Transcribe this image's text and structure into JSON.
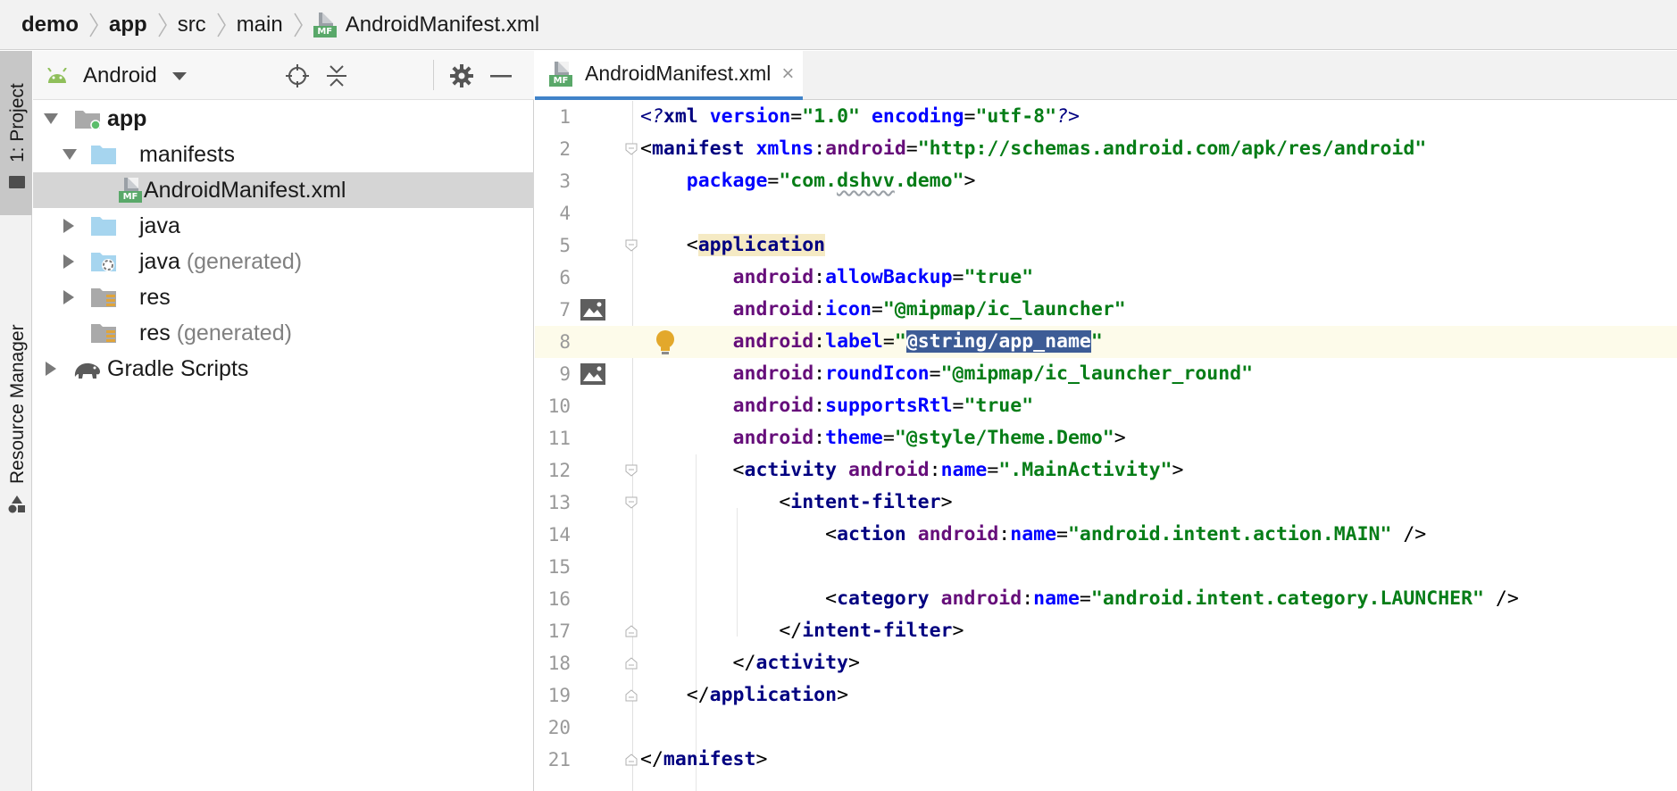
{
  "breadcrumb": {
    "items": [
      "demo",
      "app",
      "src",
      "main"
    ],
    "file": "AndroidManifest.xml",
    "file_icon_tag": "MF"
  },
  "tool_stripe": {
    "project_label": "1: Project",
    "resource_label": "Resource Manager"
  },
  "project_panel": {
    "view_mode": "Android",
    "icons": [
      "android-icon",
      "locate-icon",
      "collapse-all-icon",
      "gear-icon",
      "minimize-icon"
    ],
    "tree": [
      {
        "label": "app",
        "suffix": "",
        "expanded": true,
        "icon": "module-folder-icon"
      },
      {
        "label": "manifests",
        "suffix": "",
        "expanded": true,
        "icon": "folder-icon"
      },
      {
        "label": "AndroidManifest.xml",
        "suffix": "",
        "selected": true,
        "icon": "manifest-file-icon"
      },
      {
        "label": "java",
        "suffix": "",
        "expanded": false,
        "icon": "folder-icon"
      },
      {
        "label": "java",
        "suffix": "(generated)",
        "expanded": false,
        "icon": "generated-folder-icon"
      },
      {
        "label": "res",
        "suffix": "",
        "expanded": false,
        "icon": "resource-folder-icon"
      },
      {
        "label": "res",
        "suffix": "(generated)",
        "icon": "resource-folder-icon"
      },
      {
        "label": "Gradle Scripts",
        "suffix": "",
        "expanded": false,
        "icon": "gradle-elephant-icon"
      }
    ]
  },
  "editor": {
    "tab_label": "AndroidManifest.xml",
    "tab_close": "×",
    "current_line": 8,
    "line_numbers": [
      "1",
      "2",
      "3",
      "4",
      "5",
      "6",
      "7",
      "8",
      "9",
      "10",
      "11",
      "12",
      "13",
      "14",
      "15",
      "16",
      "17",
      "18",
      "19",
      "20",
      "21"
    ],
    "tokens": {
      "xml_decl_open": "<?",
      "xml": "xml",
      "version_attr": "version",
      "version_val": "\"1.0\"",
      "encoding_attr": "encoding",
      "encoding_val": "\"utf-8\"",
      "xml_decl_close": "?>",
      "manifest": "manifest",
      "xmlns": "xmlns",
      "android": "android",
      "schema_val": "\"http://schemas.android.com/apk/res/android\"",
      "package_attr": "package",
      "package_val_a": "\"com.",
      "package_val_b": "dshvv",
      "package_val_c": ".demo\"",
      "application": "application",
      "allowBackup": "allowBackup",
      "true_val": "\"true\"",
      "icon_attr": "icon",
      "icon_val": "\"@mipmap/ic_launcher\"",
      "label_attr": "label",
      "quote": "\"",
      "label_val_sel": "@string/app_name",
      "roundIcon_attr": "roundIcon",
      "roundIcon_val": "\"@mipmap/ic_launcher_round\"",
      "supportsRtl_attr": "supportsRtl",
      "theme_attr": "theme",
      "theme_val": "\"@style/Theme.Demo\"",
      "activity": "activity",
      "name_attr": "name",
      "activity_val": "\".MainActivity\"",
      "intent_filter": "intent-filter",
      "action": "action",
      "action_val": "\"android.intent.action.MAIN\"",
      "category": "category",
      "category_val": "\"android.intent.category.LAUNCHER\""
    }
  },
  "colors": {
    "tag": "#000080",
    "namespace": "#660e7a",
    "attribute": "#0000ff",
    "value": "#067d17",
    "selection": "#3d5c96",
    "tag_highlight": "#f5eac4",
    "current_line": "#fdfbea",
    "manifest_badge": "#59a869",
    "tab_underline": "#4083c9"
  }
}
